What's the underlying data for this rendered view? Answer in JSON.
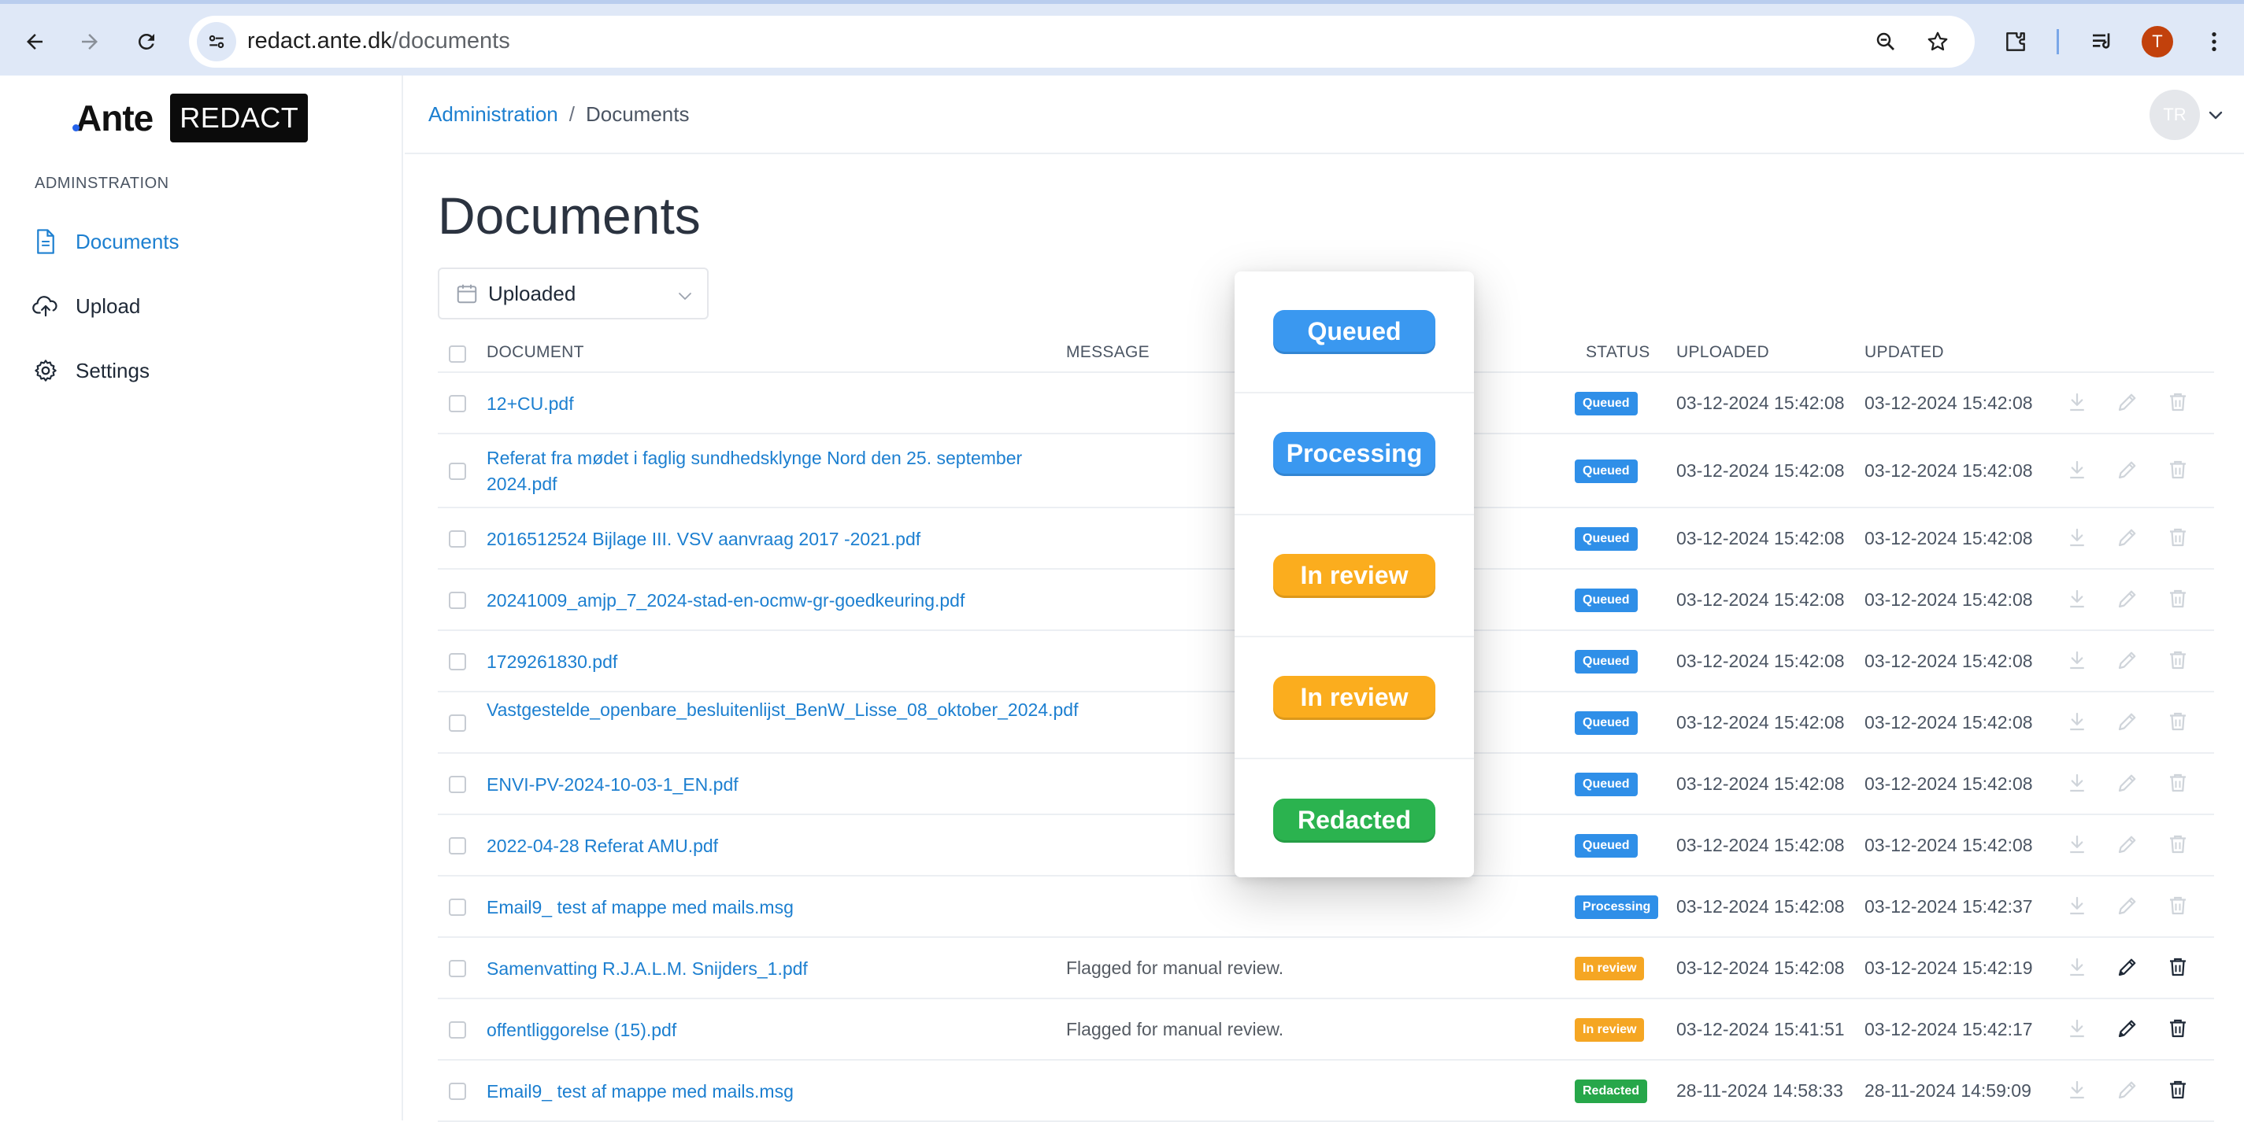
{
  "browser": {
    "url_host": "redact.ante.dk",
    "url_path": "/documents",
    "profile_initial": "T"
  },
  "sidebar": {
    "logo_text": "Ante",
    "logo_badge": "REDACT",
    "section_label": "ADMINSTRATION",
    "items": [
      {
        "label": "Documents",
        "icon": "document-icon",
        "active": true
      },
      {
        "label": "Upload",
        "icon": "cloud-upload-icon",
        "active": false
      },
      {
        "label": "Settings",
        "icon": "gear-icon",
        "active": false
      }
    ]
  },
  "header": {
    "breadcrumb": {
      "root": "Administration",
      "separator": "/",
      "current": "Documents"
    },
    "avatar_initials": "TR"
  },
  "page": {
    "title": "Documents",
    "filter": {
      "selected": "Uploaded",
      "icon": "calendar-icon"
    }
  },
  "table": {
    "columns": {
      "document": "DOCUMENT",
      "message": "MESSAGE",
      "status": "STATUS",
      "uploaded": "UPLOADED",
      "updated": "UPDATED"
    },
    "rows": [
      {
        "document": "12+CU.pdf",
        "message": "",
        "status": "Queued",
        "uploaded": "03-12-2024 15:42:08",
        "updated": "03-12-2024 15:42:08",
        "actions_enabled": false
      },
      {
        "document": "Referat fra mødet i faglig sundhedsklynge Nord den 25. september 2024.pdf",
        "message": "",
        "status": "Queued",
        "uploaded": "03-12-2024 15:42:08",
        "updated": "03-12-2024 15:42:08",
        "actions_enabled": false
      },
      {
        "document": "2016512524 Bijlage III. VSV aanvraag 2017 -2021.pdf",
        "message": "",
        "status": "Queued",
        "uploaded": "03-12-2024 15:42:08",
        "updated": "03-12-2024 15:42:08",
        "actions_enabled": false
      },
      {
        "document": "20241009_amjp_7_2024-stad-en-ocmw-gr-goedkeuring.pdf",
        "message": "",
        "status": "Queued",
        "uploaded": "03-12-2024 15:42:08",
        "updated": "03-12-2024 15:42:08",
        "actions_enabled": false
      },
      {
        "document": "1729261830.pdf",
        "message": "",
        "status": "Queued",
        "uploaded": "03-12-2024 15:42:08",
        "updated": "03-12-2024 15:42:08",
        "actions_enabled": false
      },
      {
        "document": "Vastgestelde_openbare_besluitenlijst_BenW_Lisse_08_oktober_2024.pdf",
        "message": "",
        "status": "Queued",
        "uploaded": "03-12-2024 15:42:08",
        "updated": "03-12-2024 15:42:08",
        "actions_enabled": false
      },
      {
        "document": "ENVI-PV-2024-10-03-1_EN.pdf",
        "message": "",
        "status": "Queued",
        "uploaded": "03-12-2024 15:42:08",
        "updated": "03-12-2024 15:42:08",
        "actions_enabled": false
      },
      {
        "document": "2022-04-28 Referat AMU.pdf",
        "message": "",
        "status": "Queued",
        "uploaded": "03-12-2024 15:42:08",
        "updated": "03-12-2024 15:42:08",
        "actions_enabled": false
      },
      {
        "document": "Email9_ test af mappe med mails.msg",
        "message": "",
        "status": "Processing",
        "uploaded": "03-12-2024 15:42:08",
        "updated": "03-12-2024 15:42:37",
        "actions_enabled": false
      },
      {
        "document": "Samenvatting R.J.A.L.M. Snijders_1.pdf",
        "message": "Flagged for manual review.",
        "status": "In review",
        "uploaded": "03-12-2024 15:42:08",
        "updated": "03-12-2024 15:42:19",
        "actions_enabled": true
      },
      {
        "document": "offentliggorelse (15).pdf",
        "message": "Flagged for manual review.",
        "status": "In review",
        "uploaded": "03-12-2024 15:41:51",
        "updated": "03-12-2024 15:42:17",
        "actions_enabled": true
      },
      {
        "document": "Email9_ test af mappe med mails.msg",
        "message": "",
        "status": "Redacted",
        "uploaded": "28-11-2024 14:58:33",
        "updated": "28-11-2024 14:59:09",
        "actions_enabled": "delete-only"
      }
    ]
  },
  "status_colors": {
    "Queued": "#2f8fe8",
    "Processing": "#2f8fe8",
    "In review": "#f5a623",
    "Redacted": "#27a74a"
  },
  "popover": {
    "items": [
      {
        "label": "Queued",
        "color": "#3a98f0"
      },
      {
        "label": "Processing",
        "color": "#3a98f0"
      },
      {
        "label": "In review",
        "color": "#fbad1e"
      },
      {
        "label": "In review",
        "color": "#fbad1e"
      },
      {
        "label": "Redacted",
        "color": "#2bb34f"
      }
    ]
  }
}
